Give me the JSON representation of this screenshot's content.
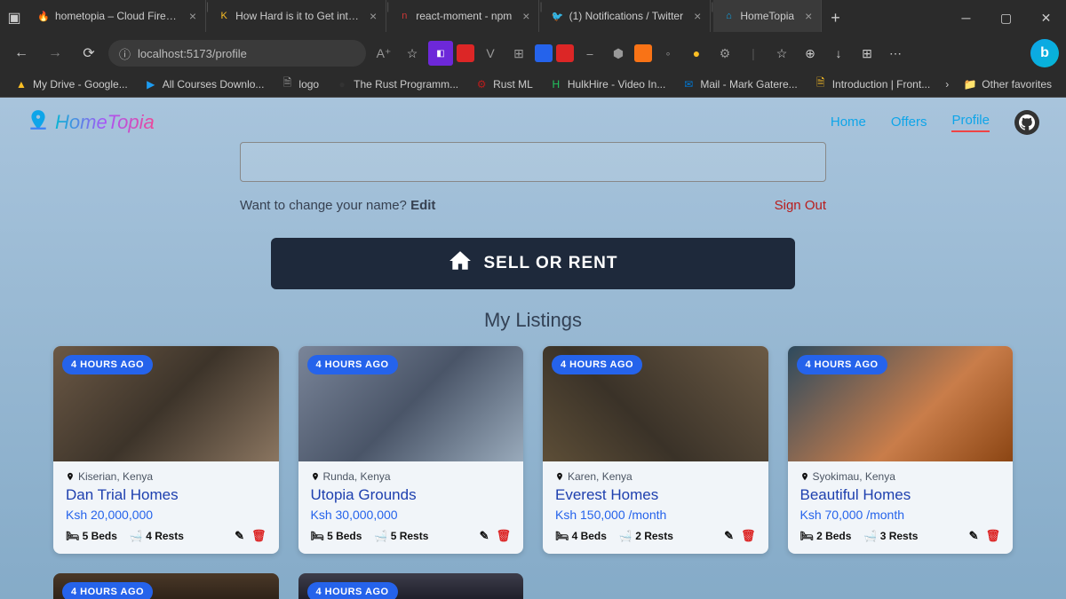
{
  "browser": {
    "tabs": [
      {
        "icon": "🔥",
        "iconColor": "#ffa500",
        "label": "hometopia – Cloud Firestore"
      },
      {
        "icon": "K",
        "iconColor": "#fbbf24",
        "label": "How Hard is it to Get into FA"
      },
      {
        "icon": "n",
        "iconColor": "#cb3837",
        "label": "react-moment - npm"
      },
      {
        "icon": "🐦",
        "iconColor": "#1d9bf0",
        "label": "(1) Notifications / Twitter"
      },
      {
        "icon": "⌂",
        "iconColor": "#0ea5e9",
        "label": "HomeTopia",
        "active": true
      }
    ],
    "url": "localhost:5173/profile",
    "bookmarks": [
      {
        "icon": "▲",
        "color": "#fbbf24",
        "label": "My Drive - Google..."
      },
      {
        "icon": "▶",
        "color": "#1d9bf0",
        "label": "All Courses Downlo..."
      },
      {
        "icon": "🗎",
        "color": "#999",
        "label": "logo"
      },
      {
        "icon": "●",
        "color": "#333",
        "label": "The Rust Programm..."
      },
      {
        "icon": "⚙",
        "color": "#b91c1c",
        "label": "Rust ML"
      },
      {
        "icon": "H",
        "color": "#22c55e",
        "label": "HulkHire - Video In..."
      },
      {
        "icon": "✉",
        "color": "#0078d4",
        "label": "Mail - Mark Gatere..."
      },
      {
        "icon": "🗎",
        "color": "#fbbf24",
        "label": "Introduction | Front..."
      }
    ],
    "otherFavorites": "Other favorites"
  },
  "app": {
    "logo": "HomeTopia",
    "nav": {
      "home": "Home",
      "offers": "Offers",
      "profile": "Profile"
    },
    "changeNamePrompt": "Want to change your name?",
    "editLabel": "Edit",
    "signOutLabel": "Sign Out",
    "sellRentLabel": "SELL OR RENT",
    "listingsTitle": "My Listings"
  },
  "listings": [
    {
      "badge": "4 HOURS AGO",
      "location": "Kiserian, Kenya",
      "title": "Dan Trial Homes",
      "price": "Ksh 20,000,000",
      "beds": "5 Beds",
      "rests": "4 Rests"
    },
    {
      "badge": "4 HOURS AGO",
      "location": "Runda, Kenya",
      "title": "Utopia Grounds",
      "price": "Ksh 30,000,000",
      "beds": "5 Beds",
      "rests": "5 Rests"
    },
    {
      "badge": "4 HOURS AGO",
      "location": "Karen, Kenya",
      "title": "Everest Homes",
      "price": "Ksh 150,000 /month",
      "beds": "4 Beds",
      "rests": "2 Rests"
    },
    {
      "badge": "4 HOURS AGO",
      "location": "Syokimau, Kenya",
      "title": "Beautiful Homes",
      "price": "Ksh 70,000 /month",
      "beds": "2 Beds",
      "rests": "3 Rests"
    }
  ],
  "listingsRow2": [
    {
      "badge": "4 HOURS AGO"
    },
    {
      "badge": "4 HOURS AGO"
    }
  ]
}
